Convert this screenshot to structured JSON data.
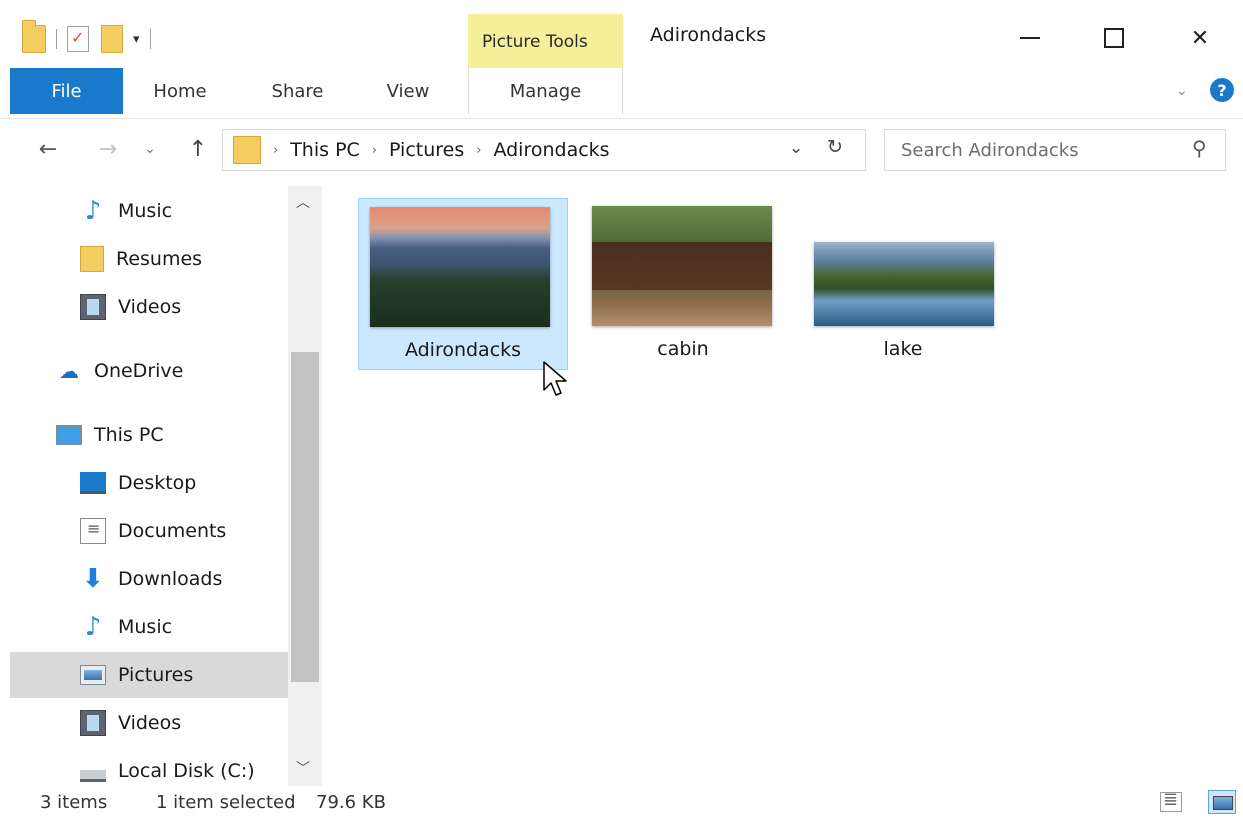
{
  "window": {
    "title": "Adirondacks",
    "context_tab_group": "Picture Tools",
    "controls": {
      "minimize": "minimize-icon",
      "maximize": "maximize-icon",
      "close": "close-icon"
    }
  },
  "ribbon": {
    "tabs": [
      {
        "label": "File",
        "active": false
      },
      {
        "label": "Home",
        "active": false
      },
      {
        "label": "Share",
        "active": false
      },
      {
        "label": "View",
        "active": false
      },
      {
        "label": "Manage",
        "active": true
      }
    ],
    "help_label": "?"
  },
  "address_bar": {
    "breadcrumbs": [
      "This PC",
      "Pictures",
      "Adirondacks"
    ],
    "search_placeholder": "Search Adirondacks"
  },
  "nav_pane": {
    "items": [
      {
        "label": "Music",
        "icon": "music-icon",
        "selected": false
      },
      {
        "label": "Resumes",
        "icon": "folder-icon",
        "selected": false
      },
      {
        "label": "Videos",
        "icon": "videos-icon",
        "selected": false
      },
      {
        "label": "OneDrive",
        "icon": "onedrive-icon",
        "selected": false
      },
      {
        "label": "This PC",
        "icon": "this-pc-icon",
        "selected": false
      },
      {
        "label": "Desktop",
        "icon": "desktop-icon",
        "selected": false
      },
      {
        "label": "Documents",
        "icon": "documents-icon",
        "selected": false
      },
      {
        "label": "Downloads",
        "icon": "downloads-icon",
        "selected": false
      },
      {
        "label": "Music",
        "icon": "music-icon",
        "selected": false
      },
      {
        "label": "Pictures",
        "icon": "pictures-icon",
        "selected": true
      },
      {
        "label": "Videos",
        "icon": "videos-icon",
        "selected": false
      },
      {
        "label": "Local Disk (C:)",
        "icon": "local-disk-icon",
        "selected": false
      }
    ]
  },
  "files": [
    {
      "name": "Adirondacks",
      "selected": true
    },
    {
      "name": "cabin",
      "selected": false
    },
    {
      "name": "lake",
      "selected": false
    }
  ],
  "status_bar": {
    "item_count": "3 items",
    "selection": "1 item selected",
    "size": "79.6 KB"
  },
  "colors": {
    "file_tab": "#1979ca",
    "context_tab": "#f5ef9a",
    "selection": "#cce8ff"
  }
}
